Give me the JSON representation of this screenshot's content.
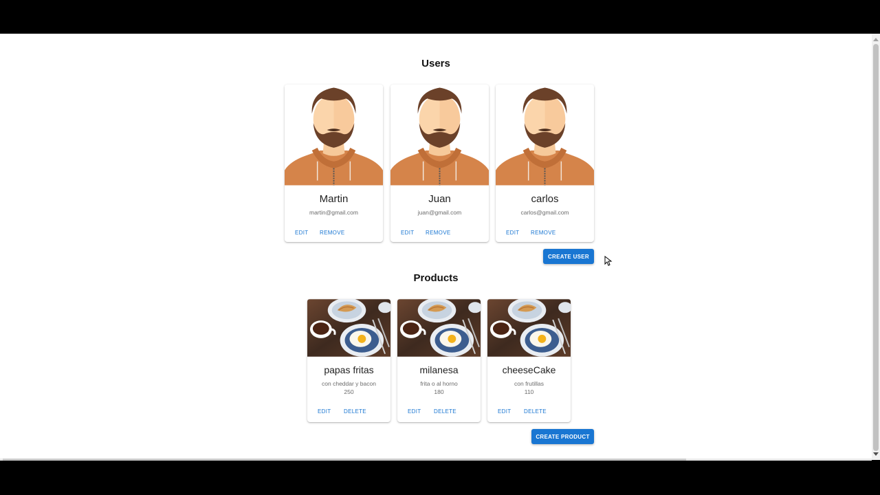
{
  "users_section": {
    "title": "Users"
  },
  "users": [
    {
      "name": "Martin",
      "email": "martin@gmail.com",
      "edit_label": "EDIT",
      "remove_label": "REMOVE"
    },
    {
      "name": "Juan",
      "email": "juan@gmail.com",
      "edit_label": "EDIT",
      "remove_label": "REMOVE"
    },
    {
      "name": "carlos",
      "email": "carlos@gmail.com",
      "edit_label": "EDIT",
      "remove_label": "REMOVE"
    }
  ],
  "create_user_label": "CREATE USER",
  "products_section": {
    "title": "Products"
  },
  "products": [
    {
      "name": "papas fritas",
      "description": "con cheddar y bacon",
      "price": "250",
      "edit_label": "EDIT",
      "delete_label": "DELETE"
    },
    {
      "name": "milanesa",
      "description": "frita o al horno",
      "price": "180",
      "edit_label": "EDIT",
      "delete_label": "DELETE"
    },
    {
      "name": "cheeseCake",
      "description": "con frutillas",
      "price": "110",
      "edit_label": "EDIT",
      "delete_label": "DELETE"
    }
  ],
  "create_product_label": "CREATE PRODUCT",
  "colors": {
    "primary": "#1976d2",
    "avatar_hoodie": "#d5844a",
    "avatar_hair": "#6b4129"
  }
}
